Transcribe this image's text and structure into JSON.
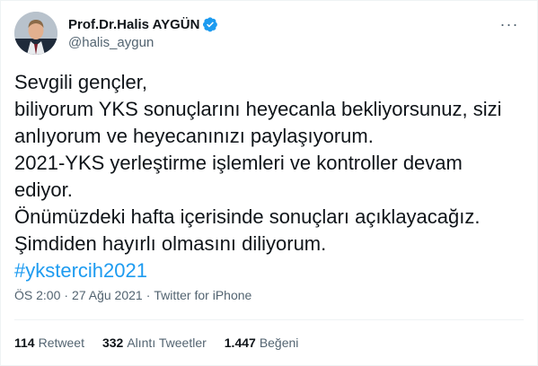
{
  "author": {
    "display_name": "Prof.Dr.Halis AYGÜN",
    "handle": "@halis_aygun",
    "verified": true,
    "avatar_icon": "profile-photo"
  },
  "tweet": {
    "lines": [
      "Sevgili gençler,",
      "biliyorum YKS sonuçlarını heyecanla bekliyorsunuz, sizi",
      "anlıyorum ve heyecanınızı paylaşıyorum.",
      "2021-YKS yerleştirme işlemleri ve kontroller devam",
      "ediyor.",
      "Önümüzdeki hafta içerisinde sonuçları açıklayacağız.",
      "Şimdiden hayırlı olmasını diliyorum."
    ],
    "hashtag": "#ykstercih2021"
  },
  "meta": {
    "time": "ÖS 2:00",
    "separator": "·",
    "date": "27 Ağu 2021",
    "source": "Twitter for iPhone"
  },
  "stats": {
    "retweets_count": "114",
    "retweets_label": "Retweet",
    "quotes_count": "332",
    "quotes_label": "Alıntı Tweetler",
    "likes_count": "1.447",
    "likes_label": "Beğeni"
  },
  "colors": {
    "accent": "#1d9bf0",
    "text": "#0f1419",
    "secondary": "#536471",
    "divider": "#eff3f4"
  }
}
